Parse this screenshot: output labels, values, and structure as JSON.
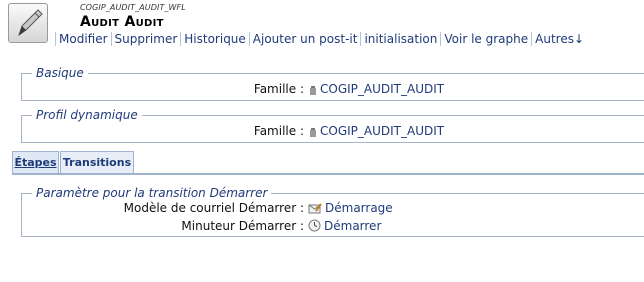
{
  "header": {
    "family_ref": "COGIP_AUDIT_AUDIT_WFL",
    "title": "Audit Audit"
  },
  "menu": [
    {
      "label": "Modifier"
    },
    {
      "label": "Supprimer"
    },
    {
      "label": "Historique"
    },
    {
      "label": "Ajouter un post-it"
    },
    {
      "label": "initialisation"
    },
    {
      "label": "Voir le graphe"
    },
    {
      "label": "Autres↓"
    }
  ],
  "sections": {
    "basique": {
      "legend": "Basique",
      "field_label": "Famille :",
      "field_value": "COGIP_AUDIT_AUDIT"
    },
    "profil": {
      "legend": "Profil dynamique",
      "field_label": "Famille :",
      "field_value": "COGIP_AUDIT_AUDIT"
    }
  },
  "tabs": [
    {
      "label": "Étapes",
      "active": true
    },
    {
      "label": "Transitions",
      "active": false
    }
  ],
  "transition": {
    "legend": "Paramètre pour la transition Démarrer",
    "rows": [
      {
        "label": "Modèle de courriel Démarrer :",
        "value": "Démarrage",
        "icon": "mail-template-icon"
      },
      {
        "label": "Minuteur Démarrer :",
        "value": "Démarrer",
        "icon": "timer-icon"
      }
    ]
  }
}
